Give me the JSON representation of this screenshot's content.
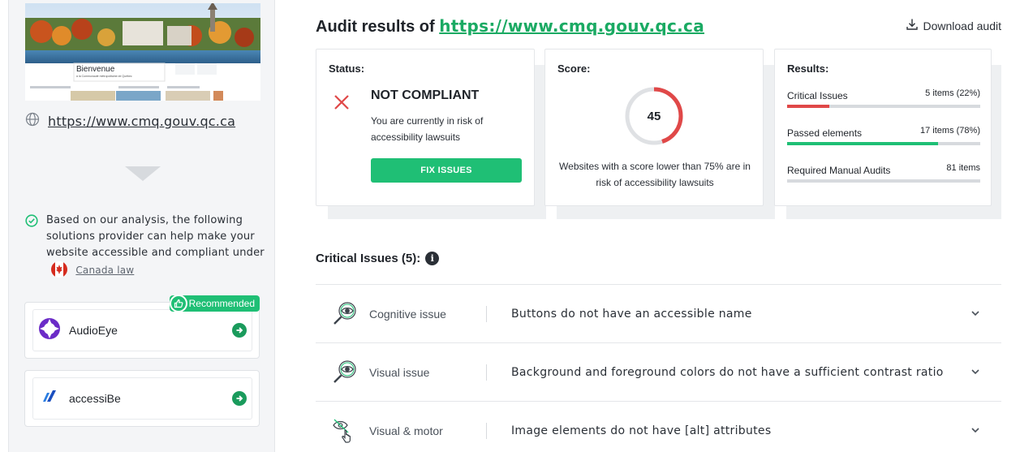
{
  "sidebar": {
    "thumbnail": {
      "banner_title": "Bienvenue",
      "banner_subtitle": "à la Communauté métropolitaine de Québec"
    },
    "site_url": "https://www.cmq.gouv.qc.ca",
    "analysis_text": "Based on our analysis, the following solutions provider can help make your website accessible and compliant under",
    "law_link": "Canada law",
    "vendors": [
      {
        "name": "AudioEye",
        "badge": "Recommended"
      },
      {
        "name": "accessiBe"
      }
    ]
  },
  "main": {
    "title_prefix": "Audit results of",
    "title_url": "https://www.cmq.gouv.qc.ca",
    "download_label": "Download audit",
    "status": {
      "label": "Status:",
      "value": "NOT COMPLIANT",
      "text": "You are currently in risk of accessibility lawsuits",
      "fix_button": "FIX ISSUES"
    },
    "score": {
      "label": "Score:",
      "value": "45",
      "percent": 45,
      "text": "Websites with a score lower than 75% are in risk of accessibility lawsuits"
    },
    "results": {
      "label": "Results:",
      "rows": [
        {
          "label": "Critical Issues",
          "value": "5 items (22%)",
          "fraction": 0.22,
          "color": "#e04848"
        },
        {
          "label": "Passed elements",
          "value": "17 items (78%)",
          "fraction": 0.78,
          "color": "#1fbf75"
        },
        {
          "label": "Required Manual Audits",
          "value": "81 items",
          "fraction": 1.0,
          "color": "#d7dade"
        }
      ]
    },
    "critical_heading": "Critical Issues (5):",
    "issues": [
      {
        "category": "Cognitive issue",
        "icon": "magnifier-eye-icon",
        "description": "Buttons do not have an accessible name"
      },
      {
        "category": "Visual issue",
        "icon": "magnifier-eye-icon",
        "description": "Background and foreground colors do not have a sufficient contrast ratio"
      },
      {
        "category": "Visual & motor",
        "icon": "eye-slash-hand-icon",
        "description": "Image elements do not have [alt] attributes"
      }
    ]
  },
  "colors": {
    "accent_green": "#1fbf75",
    "link_green": "#1aaa63",
    "danger_red": "#e04848"
  }
}
